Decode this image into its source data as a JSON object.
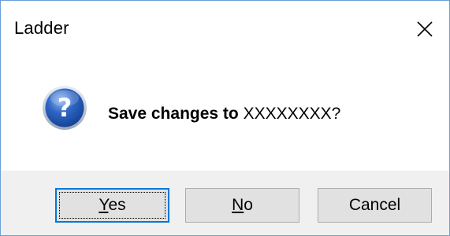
{
  "window": {
    "title": "Ladder",
    "close_glyph": "close-icon"
  },
  "message": {
    "prefix": "Save changes to ",
    "filename": "XXXXXXXX?",
    "icon": "question-icon"
  },
  "buttons": {
    "yes_label": "Yes",
    "yes_mnemonic": "Y",
    "yes_rest": "es",
    "no_label": "No",
    "no_mnemonic": "N",
    "no_rest": "o",
    "cancel_label": "Cancel"
  },
  "colors": {
    "accent": "#0078d7",
    "footer_bg": "#f0f0f0",
    "button_bg": "#e1e1e1",
    "window_border": "#6a9ed8"
  }
}
